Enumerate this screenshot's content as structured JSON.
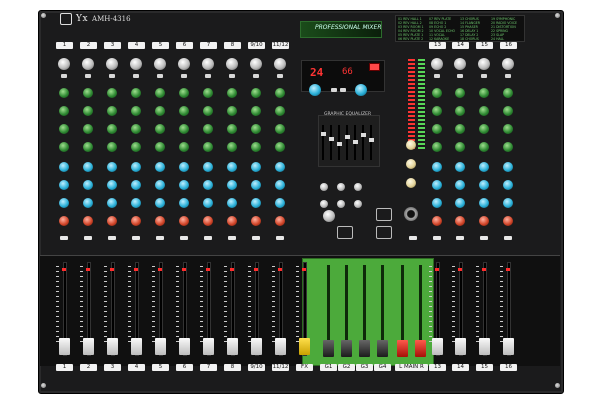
{
  "brand": {
    "logo_text": "Yx",
    "model": "AMH-4316"
  },
  "top_labels": [
    "1",
    "2",
    "3",
    "4",
    "5",
    "6",
    "7",
    "8",
    "9/10",
    "11/12"
  ],
  "right_top_labels": [
    "13",
    "14",
    "15",
    "16"
  ],
  "bottom_labels": [
    "1",
    "2",
    "3",
    "4",
    "5",
    "6",
    "7",
    "8",
    "9/10",
    "11/12",
    "FX"
  ],
  "right_bottom_labels": [
    "13",
    "14",
    "15",
    "16"
  ],
  "group_labels": [
    "G1",
    "G2",
    "G3",
    "G4"
  ],
  "main_label": "L  MAIN  R",
  "effects_banner": "PROFESSIONAL MIXER",
  "geq_title": "GRAPHIC EQUALIZER",
  "lcd": {
    "main": "24",
    "aux": "66"
  },
  "effects_list": [
    "01 REV HALL 1",
    "02 REV HALL 2",
    "03 REV ROOM 1",
    "04 REV ROOM 2",
    "05 REV PLATE 1",
    "06 REV PLATE 2",
    "07 REV PLATE",
    "08 ECHO 1",
    "09 ECHO 2",
    "10 VOCAL ECHO",
    "11 VOCAL",
    "12 KARAOKE",
    "13 CHORUS",
    "14 FLANGER",
    "15 PHASER",
    "16 DELAY 1",
    "17 DELAY 2",
    "18 CHORUS",
    "19 SYMPHONIC",
    "20 RADIO VOICE",
    "21 DISTORTION",
    "22 SPRING",
    "23 SLAP",
    "24 HALL"
  ],
  "colors": {
    "panel": "#1b1b1c",
    "green": "#4caa3b",
    "red": "#d2462a",
    "blue": "#2ab0d8"
  }
}
